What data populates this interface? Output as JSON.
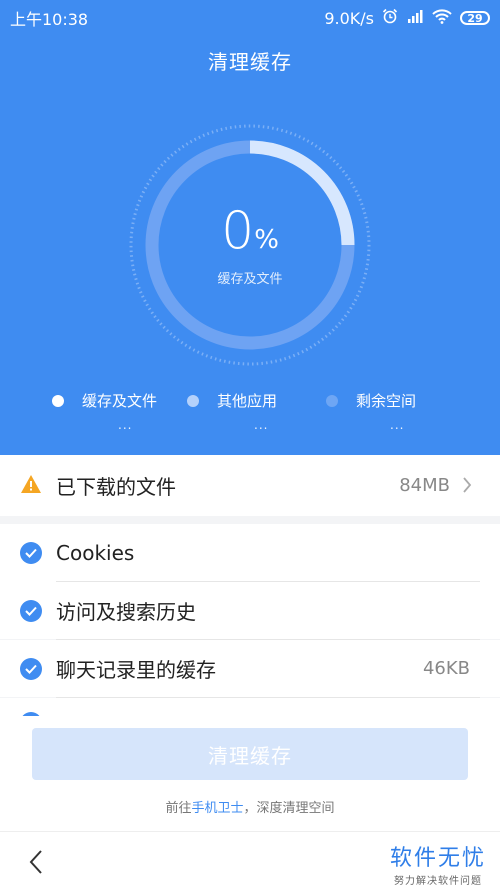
{
  "status": {
    "time": "上午10:38",
    "speed": "9.0K/s",
    "battery": "29"
  },
  "header": {
    "title": "清理缓存"
  },
  "gauge": {
    "percent_value": 0,
    "percent_text": "0",
    "percent_sign": "%",
    "label": "缓存及文件"
  },
  "legend": [
    {
      "label": "缓存及文件",
      "value": "...",
      "color": "#ffffff"
    },
    {
      "label": "其他应用",
      "value": "...",
      "color": "#b4d1fb"
    },
    {
      "label": "剩余空间",
      "value": "...",
      "color": "#6ea6f4"
    }
  ],
  "downloads": {
    "icon": "warning-icon",
    "label": "已下载的文件",
    "size": "84MB"
  },
  "items": [
    {
      "label": "Cookies",
      "size": "",
      "checked": true
    },
    {
      "label": "访问及搜索历史",
      "size": "",
      "checked": true
    },
    {
      "label": "聊天记录里的缓存",
      "size": "46KB",
      "checked": true
    }
  ],
  "action": {
    "button_label": "清理缓存",
    "hint_prefix": "前往",
    "hint_link": "手机卫士",
    "hint_suffix": "，深度清理空间"
  },
  "watermark": {
    "title": "软件无忧",
    "subtitle": "努力解决软件问题"
  },
  "colors": {
    "brand": "#3f8cf1",
    "warning": "#f5a623"
  }
}
